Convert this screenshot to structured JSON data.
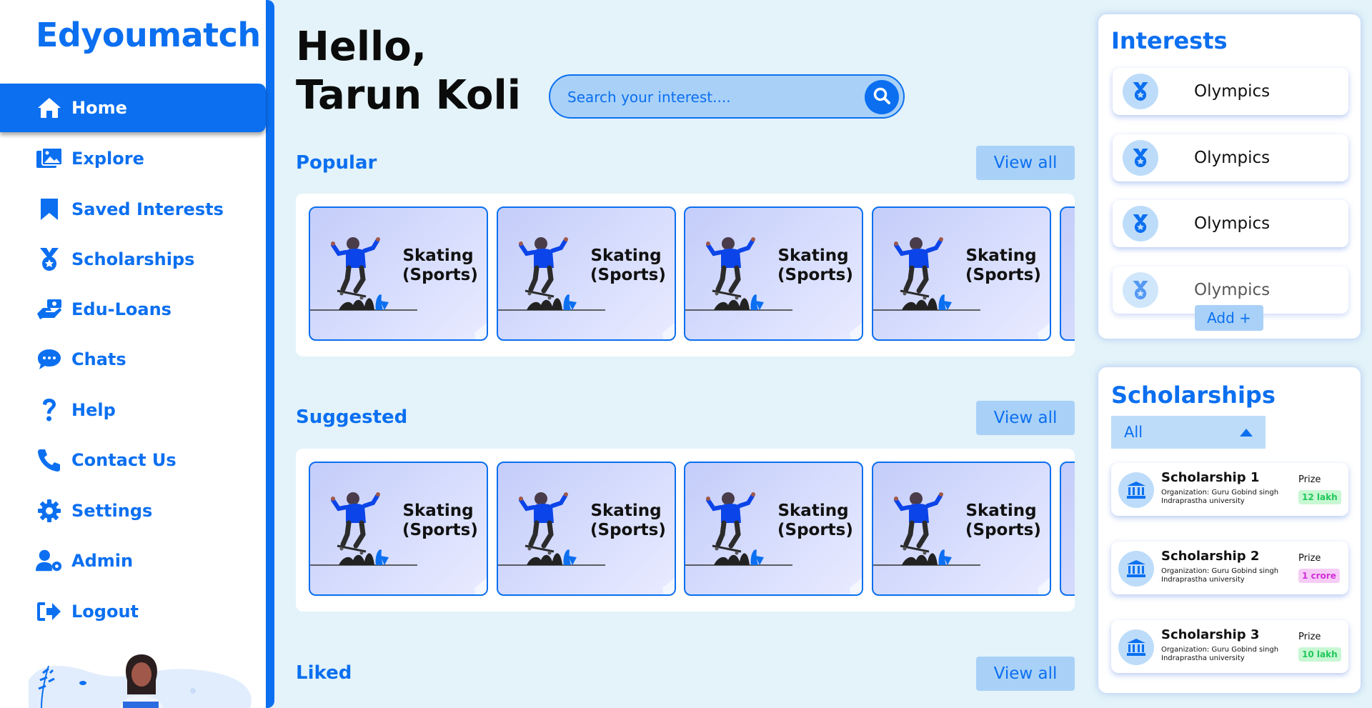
{
  "app": {
    "name": "Edyoumatch"
  },
  "sidebar": {
    "items": [
      {
        "label": "Home",
        "icon": "home-icon",
        "active": true
      },
      {
        "label": "Explore",
        "icon": "image-icon"
      },
      {
        "label": "Saved Interests",
        "icon": "bookmark-icon"
      },
      {
        "label": "Scholarships",
        "icon": "medal-icon"
      },
      {
        "label": "Edu-Loans",
        "icon": "hand-money-icon"
      },
      {
        "label": "Chats",
        "icon": "chat-bubble-icon"
      },
      {
        "label": "Help",
        "icon": "question-icon"
      },
      {
        "label": "Contact Us",
        "icon": "phone-icon"
      },
      {
        "label": "Settings",
        "icon": "gear-icon"
      },
      {
        "label": "Admin",
        "icon": "user-gear-icon"
      },
      {
        "label": "Logout",
        "icon": "logout-icon"
      }
    ]
  },
  "greeting": {
    "line1": "Hello,",
    "line2": "Tarun Koli"
  },
  "search": {
    "placeholder": "Search your interest...."
  },
  "sections": [
    {
      "title": "Popular",
      "view_all": "View all",
      "cards": [
        {
          "label1": "Skating",
          "label2": "(Sports)"
        },
        {
          "label1": "Skating",
          "label2": "(Sports)"
        },
        {
          "label1": "Skating",
          "label2": "(Sports)"
        },
        {
          "label1": "Skating",
          "label2": "(Sports)"
        }
      ]
    },
    {
      "title": "Suggested",
      "view_all": "View all",
      "cards": [
        {
          "label1": "Skating",
          "label2": "(Sports)"
        },
        {
          "label1": "Skating",
          "label2": "(Sports)"
        },
        {
          "label1": "Skating",
          "label2": "(Sports)"
        },
        {
          "label1": "Skating",
          "label2": "(Sports)"
        }
      ]
    },
    {
      "title": "Liked",
      "view_all": "View all"
    }
  ],
  "interests": {
    "title": "Interests",
    "items": [
      {
        "label": "Olympics"
      },
      {
        "label": "Olympics"
      },
      {
        "label": "Olympics"
      },
      {
        "label": "Olympics"
      }
    ],
    "add_label": "Add +"
  },
  "scholarships": {
    "title": "Scholarships",
    "filter": "All",
    "items": [
      {
        "name": "Scholarship 1",
        "org": "Organization: Guru Gobind singh Indraprastha university",
        "prize_label": "Prize",
        "prize": "12 lakh",
        "prize_bg": "#c8f7d3",
        "prize_fg": "#1fc85a"
      },
      {
        "name": "Scholarship 2",
        "org": "Organization: Guru Gobind singh Indraprastha university",
        "prize_label": "Prize",
        "prize": "1 crore",
        "prize_bg": "#f6ccf7",
        "prize_fg": "#d12fd8"
      },
      {
        "name": "Scholarship 3",
        "org": "Organization: Guru Gobind singh Indraprastha university",
        "prize_label": "Prize",
        "prize": "10 lakh",
        "prize_bg": "#c8f7d3",
        "prize_fg": "#1fc85a"
      }
    ]
  },
  "colors": {
    "accent": "#0b6ff0",
    "accent_light": "#a9d1f8",
    "background": "#e3f3f9"
  }
}
